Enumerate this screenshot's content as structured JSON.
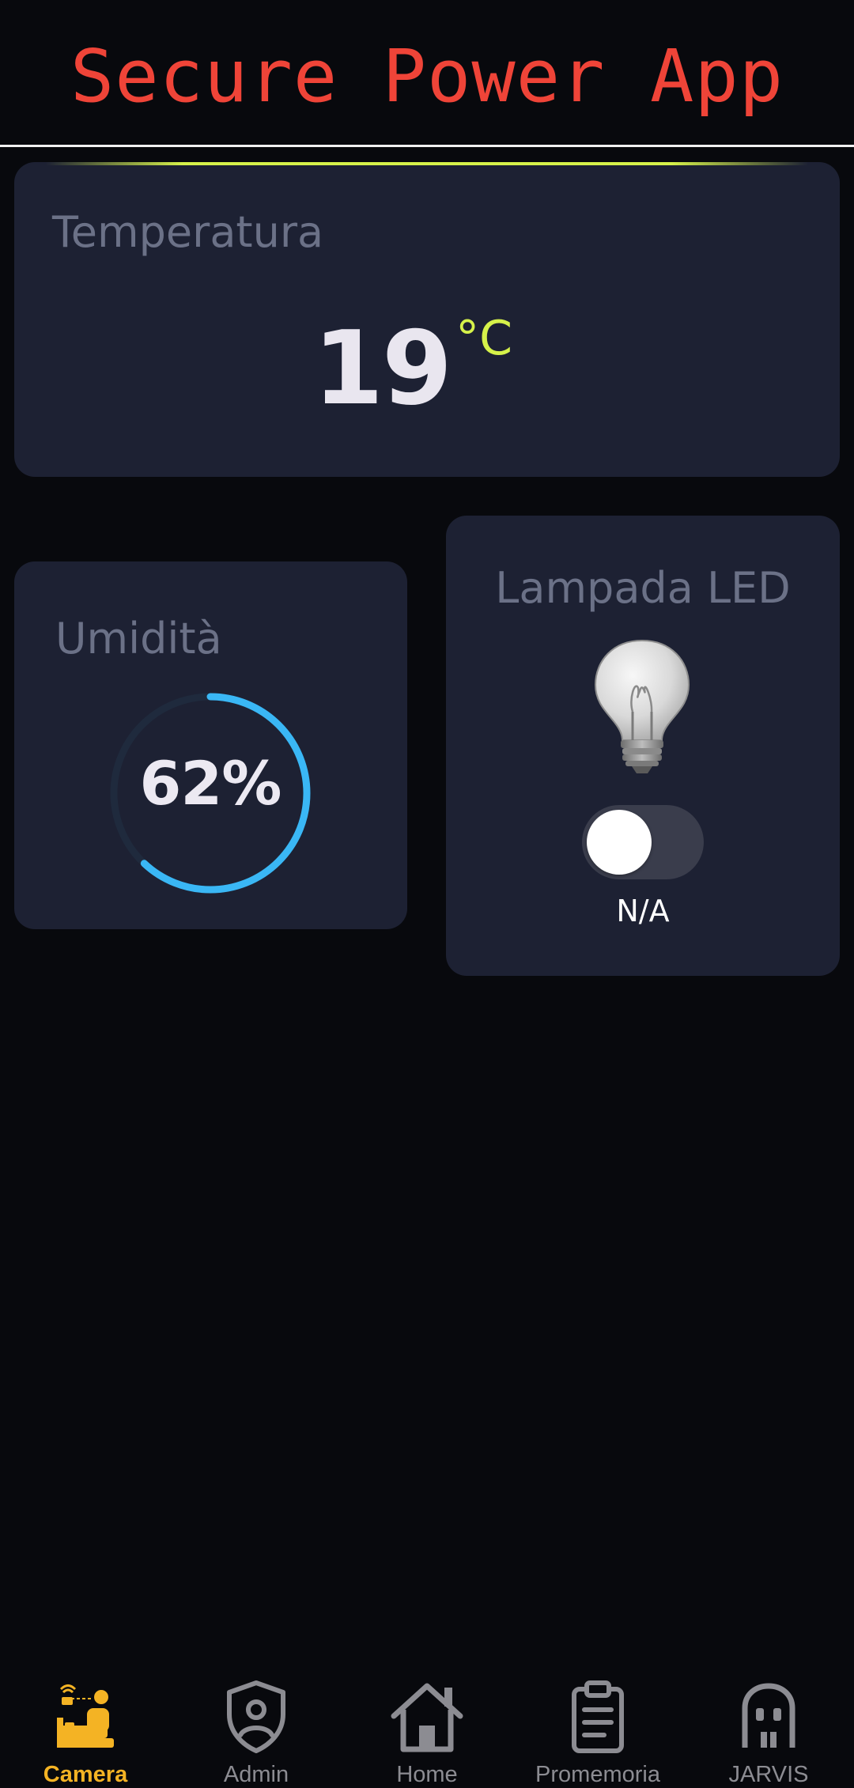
{
  "app": {
    "title": "Secure Power App"
  },
  "temperature": {
    "label": "Temperatura",
    "value": "19",
    "unit": "°C"
  },
  "humidity": {
    "label": "Umidità",
    "value_text": "62%",
    "percent": 62
  },
  "lamp": {
    "label": "Lampada LED",
    "state_on": false,
    "status": "N/A"
  },
  "nav": {
    "items": [
      {
        "label": "Camera",
        "icon": "camera-room-icon",
        "active": true
      },
      {
        "label": "Admin",
        "icon": "shield-user-icon",
        "active": false
      },
      {
        "label": "Home",
        "icon": "house-icon",
        "active": false
      },
      {
        "label": "Promemoria",
        "icon": "clipboard-icon",
        "active": false
      },
      {
        "label": "JARVIS",
        "icon": "ghost-icon",
        "active": false
      }
    ]
  },
  "colors": {
    "background": "#08090d",
    "card": "#1d2133",
    "title": "#ef4438",
    "accent_lime": "#d6f24a",
    "humidity_ring": "#3ab7f5",
    "nav_active": "#f4b324",
    "nav_inactive": "#8c8c92"
  }
}
